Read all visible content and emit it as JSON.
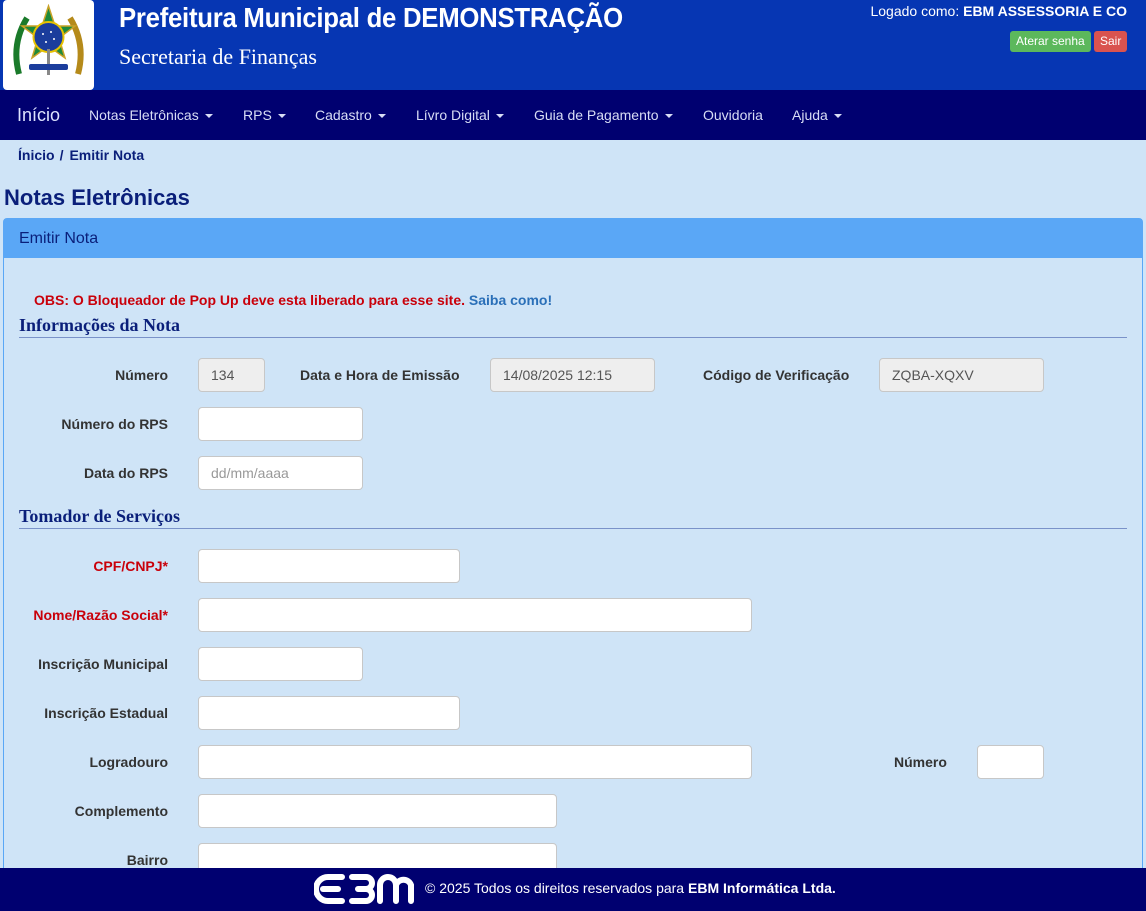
{
  "header": {
    "title": "Prefeitura Municipal de DEMONSTRAÇÃO",
    "subtitle": "Secretaria de Finanças",
    "login_prefix": "Logado como:",
    "login_user": "EBM ASSESSORIA E CO",
    "change_password_label": "Aterar senha",
    "logout_label": "Sair"
  },
  "nav": {
    "brand": "Início",
    "items": [
      "Notas Eletrônicas",
      "RPS",
      "Cadastro",
      "Lívro Digital",
      "Guia de Pagamento",
      "Ouvidoria",
      "Ajuda"
    ]
  },
  "breadcrumb": {
    "home": "Ínicio",
    "separator": "/",
    "current": "Emitir Nota"
  },
  "page_title": "Notas Eletrônicas",
  "panel_heading": "Emitir Nota",
  "obs": {
    "text": "OBS: O Bloqueador de Pop Up deve esta liberado para esse site.",
    "link": "Saiba como!"
  },
  "info": {
    "section": "Informações da Nota",
    "numero_label": "Número",
    "numero_value": "134",
    "data_emissao_label": "Data e Hora de Emissão",
    "data_emissao_value": "14/08/2025 12:15",
    "codigo_label": "Código de Verificação",
    "codigo_value": "ZQBA-XQXV",
    "rps_numero_label": "Número do RPS",
    "rps_numero_value": "",
    "rps_data_label": "Data do RPS",
    "rps_data_placeholder": "dd/mm/aaaa"
  },
  "tomador": {
    "section": "Tomador de Serviços",
    "cpf_label": "CPF/CNPJ*",
    "nome_label": "Nome/Razão Social*",
    "inscricao_municipal_label": "Inscrição Municipal",
    "inscricao_estadual_label": "Inscrição Estadual",
    "logradouro_label": "Logradouro",
    "numero_label": "Número",
    "complemento_label": "Complemento",
    "bairro_label": "Bairro"
  },
  "footer": {
    "text": "© 2025 Todos os direitos reservados para",
    "company": "EBM Informática Ltda."
  }
}
